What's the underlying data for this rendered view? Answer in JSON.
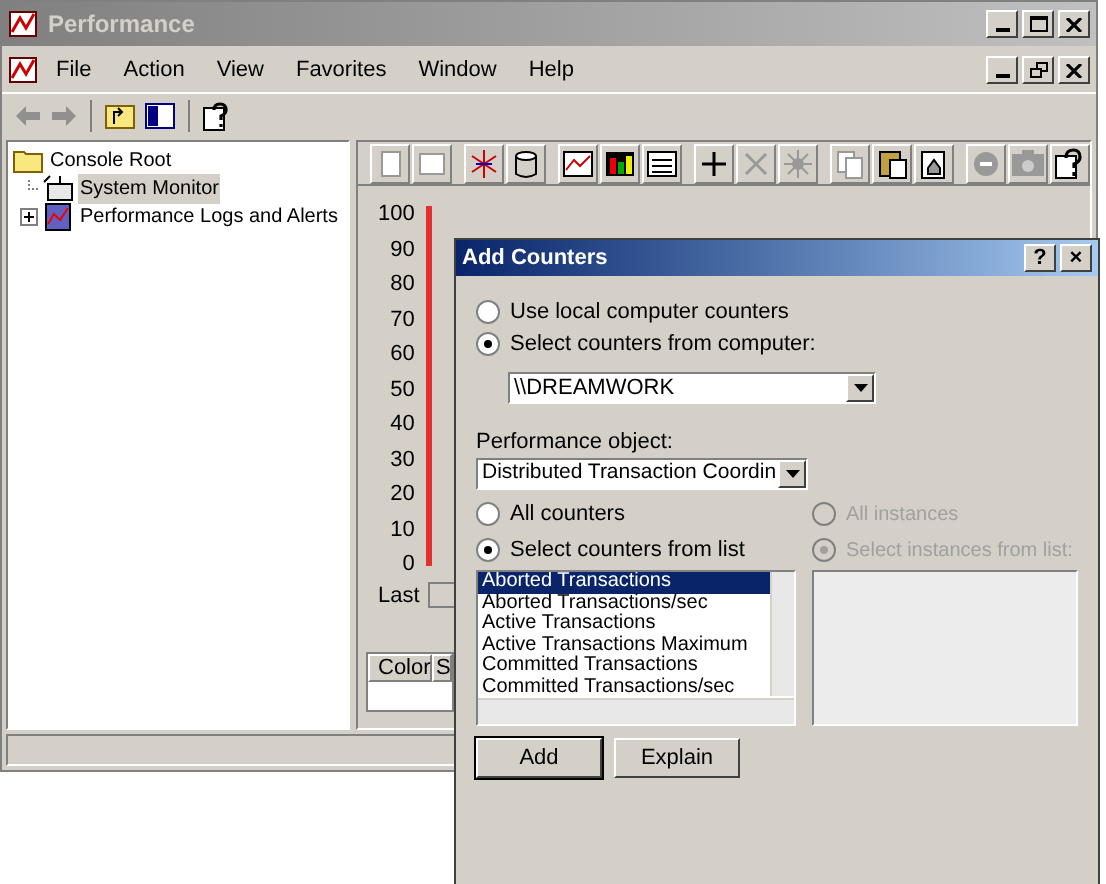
{
  "window": {
    "title": "Performance"
  },
  "menu": [
    "File",
    "Action",
    "View",
    "Favorites",
    "Window",
    "Help"
  ],
  "tree": [
    {
      "label": "Console Root",
      "selected": false,
      "expandable": false,
      "children": [
        {
          "label": "System Monitor",
          "selected": true,
          "expandable": false
        },
        {
          "label": "Performance Logs and Alerts",
          "selected": false,
          "expandable": true
        }
      ]
    }
  ],
  "chart": {
    "y_axis_labels": [
      "100",
      "90",
      "80",
      "70",
      "60",
      "50",
      "40",
      "30",
      "20",
      "10",
      "0"
    ],
    "last_label": "Last",
    "legend_columns": [
      "Color",
      "S"
    ]
  },
  "dialog": {
    "title": "Add Counters",
    "help_button": "?",
    "close_button": "×",
    "source_options": [
      {
        "label": "Use local computer counters",
        "selected": false
      },
      {
        "label": "Select counters from computer:",
        "selected": true
      }
    ],
    "computer": "\\\\DREAMWORK",
    "object_label": "Performance object:",
    "object_value": "Distributed Transaction Coordin",
    "counter_modes": [
      {
        "label": "All counters",
        "selected": false
      },
      {
        "label": "Select counters from list",
        "selected": true
      }
    ],
    "instance_modes": [
      {
        "label": "All instances",
        "selected": false,
        "disabled": true
      },
      {
        "label": "Select instances from list:",
        "selected": true,
        "disabled": true
      }
    ],
    "counters": [
      {
        "label": "Aborted Transactions",
        "selected": true
      },
      {
        "label": "Aborted Transactions/sec",
        "selected": false
      },
      {
        "label": "Active Transactions",
        "selected": false
      },
      {
        "label": "Active Transactions Maximum",
        "selected": false
      },
      {
        "label": "Committed Transactions",
        "selected": false
      },
      {
        "label": "Committed Transactions/sec",
        "selected": false
      }
    ],
    "buttons": [
      "Add",
      "Explain"
    ]
  }
}
